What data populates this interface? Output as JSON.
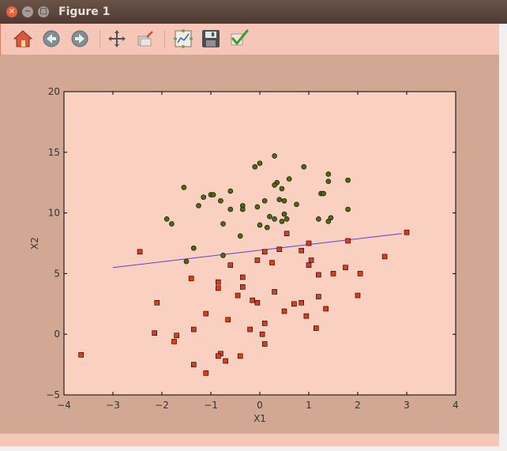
{
  "window": {
    "title": "Figure 1",
    "close_symbol": "×",
    "minimize_symbol": "−",
    "maximize_symbol": "□"
  },
  "toolbar": {
    "buttons": [
      {
        "icon": "home-icon"
      },
      {
        "icon": "back-arrow-icon"
      },
      {
        "icon": "forward-arrow-icon"
      },
      {
        "icon": "pan-move-icon"
      },
      {
        "icon": "zoom-rect-icon"
      },
      {
        "icon": "configure-subplots-icon"
      },
      {
        "icon": "save-floppy-icon"
      },
      {
        "icon": "edit-checkmark-icon"
      }
    ]
  },
  "colors": {
    "plot_bg": "#fad0c1",
    "figure_bg": "#d2a794",
    "class_circle": "#4f6b10",
    "class_square": "#e03a1c",
    "boundary_line": "#5b3fd6"
  },
  "chart_data": {
    "type": "scatter",
    "xlabel": "X1",
    "ylabel": "X2",
    "xlim": [
      -4,
      4
    ],
    "ylim": [
      -5,
      20
    ],
    "xticks": [
      -4,
      -3,
      -2,
      -1,
      0,
      1,
      2,
      3,
      4
    ],
    "yticks": [
      -5,
      0,
      5,
      10,
      15,
      20
    ],
    "xtick_labels": [
      "−4",
      "−3",
      "−2",
      "−1",
      "0",
      "1",
      "2",
      "3",
      "4"
    ],
    "ytick_labels": [
      "−5",
      "0",
      "5",
      "10",
      "15",
      "20"
    ],
    "line": {
      "x": [
        -3.0,
        2.9
      ],
      "y": [
        5.5,
        8.3
      ]
    },
    "series": [
      {
        "marker": "circle",
        "points": [
          [
            0.3,
            14.7
          ],
          [
            0.9,
            13.8
          ],
          [
            -0.1,
            13.8
          ],
          [
            0.0,
            14.1
          ],
          [
            1.4,
            13.2
          ],
          [
            1.8,
            12.7
          ],
          [
            0.6,
            12.8
          ],
          [
            1.4,
            12.6
          ],
          [
            0.35,
            12.5
          ],
          [
            0.3,
            12.3
          ],
          [
            -1.55,
            12.1
          ],
          [
            0.45,
            12.0
          ],
          [
            -0.6,
            11.8
          ],
          [
            -1.0,
            11.5
          ],
          [
            -0.95,
            11.5
          ],
          [
            1.25,
            11.6
          ],
          [
            1.3,
            11.6
          ],
          [
            -1.15,
            11.3
          ],
          [
            0.4,
            11.1
          ],
          [
            0.1,
            11.0
          ],
          [
            -0.8,
            11.0
          ],
          [
            0.5,
            11.0
          ],
          [
            0.75,
            10.7
          ],
          [
            -1.25,
            10.6
          ],
          [
            -0.35,
            10.6
          ],
          [
            -0.05,
            10.5
          ],
          [
            -0.6,
            10.3
          ],
          [
            -0.35,
            10.3
          ],
          [
            1.8,
            10.3
          ],
          [
            0.5,
            9.9
          ],
          [
            0.2,
            9.7
          ],
          [
            0.3,
            9.5
          ],
          [
            1.45,
            9.6
          ],
          [
            1.2,
            9.5
          ],
          [
            1.4,
            9.3
          ],
          [
            -1.9,
            9.5
          ],
          [
            -1.8,
            9.1
          ],
          [
            0.45,
            9.3
          ],
          [
            0.55,
            9.5
          ],
          [
            0.0,
            9.0
          ],
          [
            -0.75,
            9.1
          ],
          [
            0.15,
            8.8
          ],
          [
            -0.4,
            8.1
          ],
          [
            1.0,
            7.5
          ],
          [
            -1.35,
            7.1
          ],
          [
            -0.75,
            6.5
          ],
          [
            -1.5,
            6.0
          ]
        ]
      },
      {
        "marker": "square",
        "points": [
          [
            3.0,
            8.4
          ],
          [
            0.55,
            8.3
          ],
          [
            1.8,
            7.7
          ],
          [
            1.0,
            7.5
          ],
          [
            -2.45,
            6.8
          ],
          [
            0.85,
            6.9
          ],
          [
            0.4,
            7.0
          ],
          [
            0.1,
            6.8
          ],
          [
            2.55,
            6.4
          ],
          [
            -0.05,
            6.1
          ],
          [
            1.05,
            6.1
          ],
          [
            1.0,
            5.7
          ],
          [
            0.25,
            5.9
          ],
          [
            -0.6,
            5.7
          ],
          [
            1.75,
            5.5
          ],
          [
            1.2,
            4.9
          ],
          [
            1.5,
            5.0
          ],
          [
            2.05,
            5.0
          ],
          [
            -0.35,
            4.7
          ],
          [
            -1.4,
            4.6
          ],
          [
            -0.85,
            4.3
          ],
          [
            -0.85,
            3.8
          ],
          [
            -0.35,
            3.9
          ],
          [
            0.3,
            3.5
          ],
          [
            -0.45,
            3.2
          ],
          [
            2.0,
            3.2
          ],
          [
            1.2,
            3.1
          ],
          [
            -0.15,
            2.8
          ],
          [
            -0.05,
            2.6
          ],
          [
            0.85,
            2.6
          ],
          [
            0.7,
            2.5
          ],
          [
            -2.1,
            2.6
          ],
          [
            1.35,
            2.1
          ],
          [
            0.5,
            1.9
          ],
          [
            -1.1,
            1.7
          ],
          [
            0.95,
            1.5
          ],
          [
            -0.65,
            1.2
          ],
          [
            0.1,
            0.9
          ],
          [
            -0.2,
            0.4
          ],
          [
            1.15,
            0.5
          ],
          [
            -1.35,
            0.4
          ],
          [
            -2.15,
            0.1
          ],
          [
            0.05,
            0.0
          ],
          [
            -1.7,
            -0.1
          ],
          [
            -1.75,
            -0.6
          ],
          [
            0.1,
            -0.8
          ],
          [
            -3.65,
            -1.7
          ],
          [
            -0.8,
            -1.6
          ],
          [
            -0.4,
            -1.8
          ],
          [
            -0.85,
            -1.8
          ],
          [
            -0.7,
            -2.2
          ],
          [
            -1.35,
            -2.5
          ],
          [
            -1.1,
            -3.2
          ]
        ]
      }
    ]
  }
}
